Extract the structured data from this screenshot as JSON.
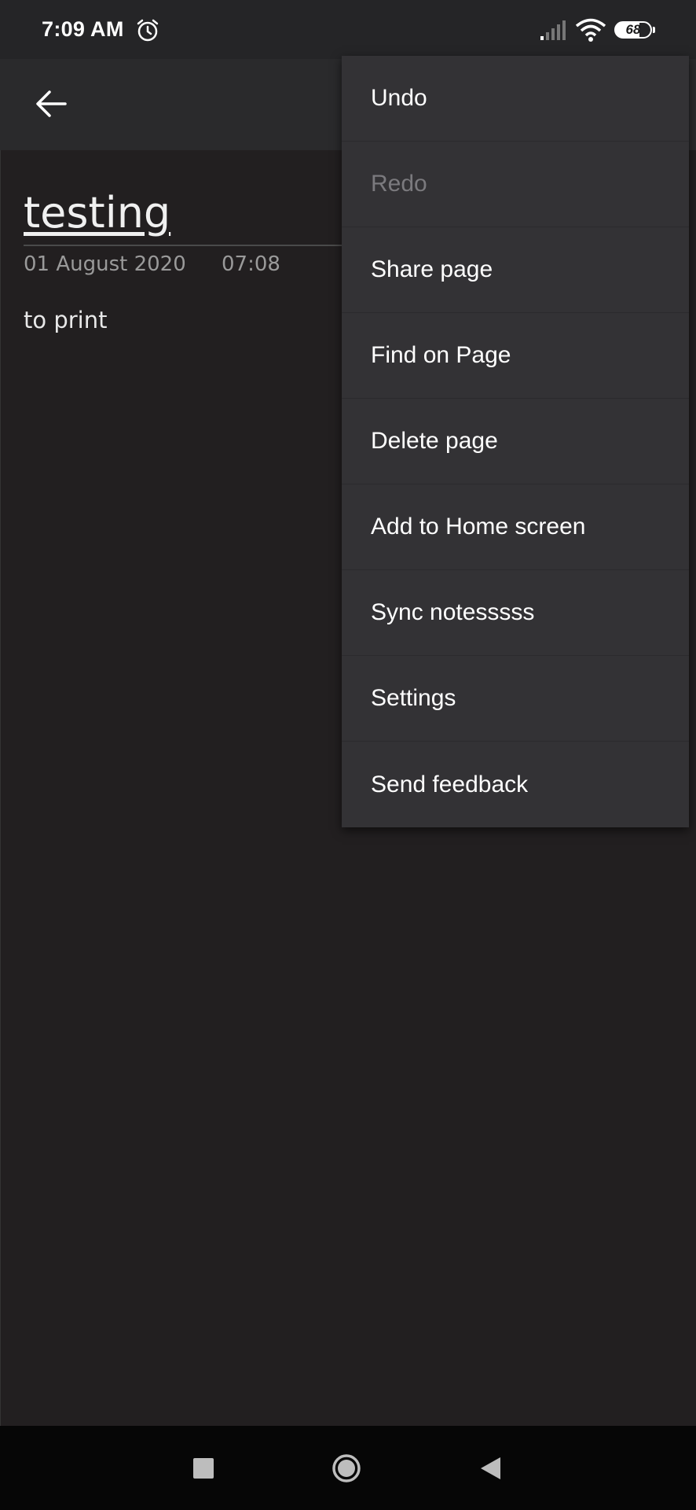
{
  "status_bar": {
    "time": "7:09 AM",
    "battery_level": "68",
    "icons": [
      "alarm-icon",
      "signal-icon",
      "wifi-icon",
      "battery-icon"
    ]
  },
  "toolbar": {
    "back_icon": "arrow-left-icon"
  },
  "note": {
    "title": "testing",
    "date": "01 August 2020",
    "time": "07:08",
    "body": "to print"
  },
  "menu": {
    "items": [
      {
        "label": "Undo",
        "enabled": true
      },
      {
        "label": "Redo",
        "enabled": false
      },
      {
        "label": "Share page",
        "enabled": true
      },
      {
        "label": "Find on Page",
        "enabled": true
      },
      {
        "label": "Delete page",
        "enabled": true
      },
      {
        "label": "Add to Home screen",
        "enabled": true
      },
      {
        "label": "Sync notesssss",
        "enabled": true
      },
      {
        "label": "Settings",
        "enabled": true
      },
      {
        "label": "Send feedback",
        "enabled": true
      }
    ]
  },
  "nav_bar": {
    "icons": [
      "recent-apps-icon",
      "home-icon",
      "back-icon"
    ]
  },
  "colors": {
    "background": "#221f20",
    "menu_background": "#333235",
    "disabled_text": "#7b7a7e"
  }
}
